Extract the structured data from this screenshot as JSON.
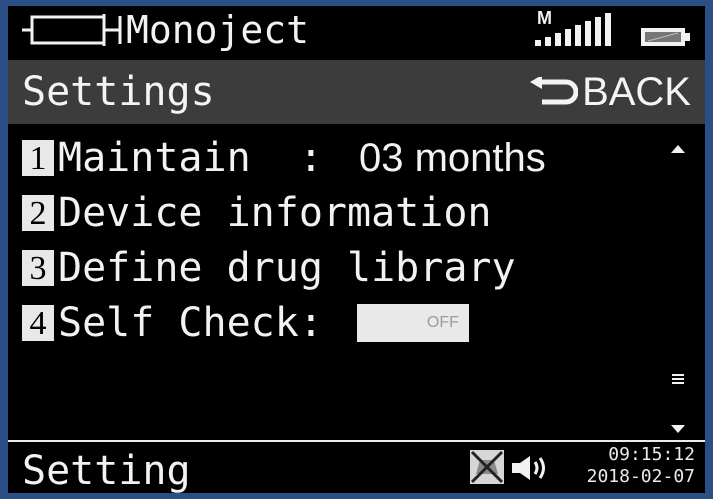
{
  "statusbar": {
    "app_title": "Monoject",
    "network_label": "M",
    "icons": [
      "syringe-icon",
      "signal-strength-icon",
      "battery-icon"
    ]
  },
  "header": {
    "title": "Settings",
    "back_label": "BACK"
  },
  "menu": {
    "items": [
      {
        "number": "1",
        "label": "Maintain  : ",
        "value": "03 months"
      },
      {
        "number": "2",
        "label": "Device information"
      },
      {
        "number": "3",
        "label": "Define drug library"
      },
      {
        "number": "4",
        "label": "Self Check:",
        "toggle": "OFF"
      }
    ]
  },
  "footer": {
    "label": "Setting",
    "time": "09:15:12",
    "date": "2018-02-07",
    "icons": [
      "mute-icon",
      "speaker-icon"
    ]
  },
  "colors": {
    "outer": "#2a4f86",
    "screen": "#000000",
    "header_bar": "#3c3c3c",
    "text": "#f2f2f2",
    "number_badge": "#e8e8e8"
  }
}
